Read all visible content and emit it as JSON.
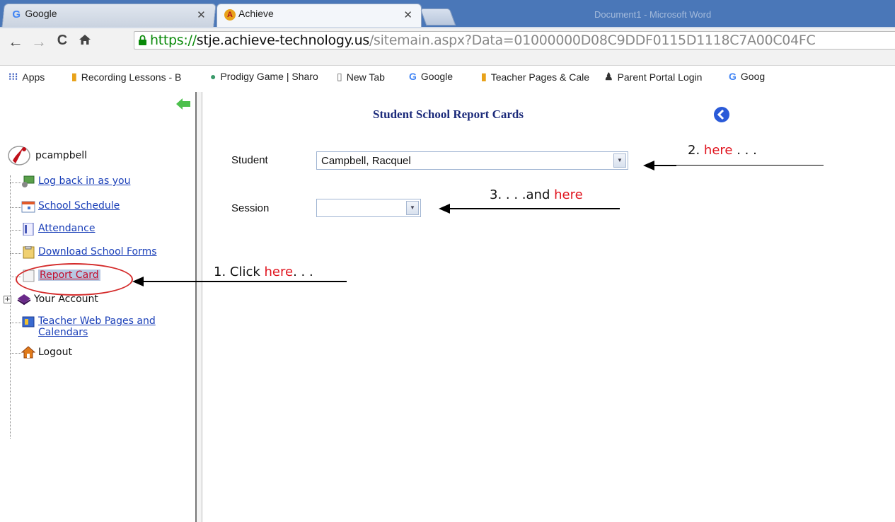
{
  "browser": {
    "tabs": [
      {
        "title": "Google",
        "icon": "google-icon",
        "active": false
      },
      {
        "title": "Achieve",
        "icon": "achieve-icon",
        "active": true
      }
    ],
    "background_window_title": "Document1 - Microsoft Word",
    "url": {
      "scheme": "https://",
      "host": "stje.achieve-technology.us",
      "path": "/sitemain.aspx?Data=01000000D08C9DDF0115D1118C7A00C04FC"
    },
    "bookmarks": [
      {
        "label": "Apps",
        "icon": "apps-grid-icon"
      },
      {
        "label": "Recording Lessons - B",
        "icon": "book-icon"
      },
      {
        "label": "Prodigy Game | Sharo",
        "icon": "prodigy-icon"
      },
      {
        "label": "New Tab",
        "icon": "page-icon"
      },
      {
        "label": "Google",
        "icon": "google-icon"
      },
      {
        "label": "Teacher Pages & Cale",
        "icon": "book-icon"
      },
      {
        "label": "Parent Portal Login",
        "icon": "people-icon"
      },
      {
        "label": "Goog",
        "icon": "google-icon"
      }
    ]
  },
  "sidebar": {
    "username": "pcampbell",
    "items": [
      {
        "label": "Log back in as you",
        "icon": "login-icon",
        "link": true
      },
      {
        "label": "School Schedule",
        "icon": "calendar-icon",
        "link": true
      },
      {
        "label": "Attendance",
        "icon": "attendance-icon",
        "link": true
      },
      {
        "label": "Download School Forms",
        "icon": "forms-icon",
        "link": true
      },
      {
        "label": "Report Card",
        "icon": "report-card-icon",
        "link": true,
        "selected": true
      },
      {
        "label": "Your Account",
        "icon": "account-icon",
        "link": false
      },
      {
        "label": "Teacher Web Pages and",
        "label2": "Calendars",
        "icon": "teacher-pages-icon",
        "link": true
      },
      {
        "label": "Logout",
        "icon": "home-icon",
        "link": false
      }
    ]
  },
  "main": {
    "title": "Student School Report Cards",
    "student_label": "Student",
    "student_value": "Campbell, Racquel",
    "session_label": "Session",
    "session_value": ""
  },
  "annotations": {
    "a1_prefix": "1. Click ",
    "a1_red": "here",
    "a1_suffix": ". . .",
    "a2_prefix": "2. ",
    "a2_red": "here",
    "a2_suffix": " . . .",
    "a3_prefix": "3. . . .and ",
    "a3_red": "here",
    "highlight_color": "#e0141e"
  },
  "colors": {
    "title_blue": "#1b2a7a",
    "link_blue": "#1a3fb8",
    "secure_green": "#0a8a0a"
  }
}
